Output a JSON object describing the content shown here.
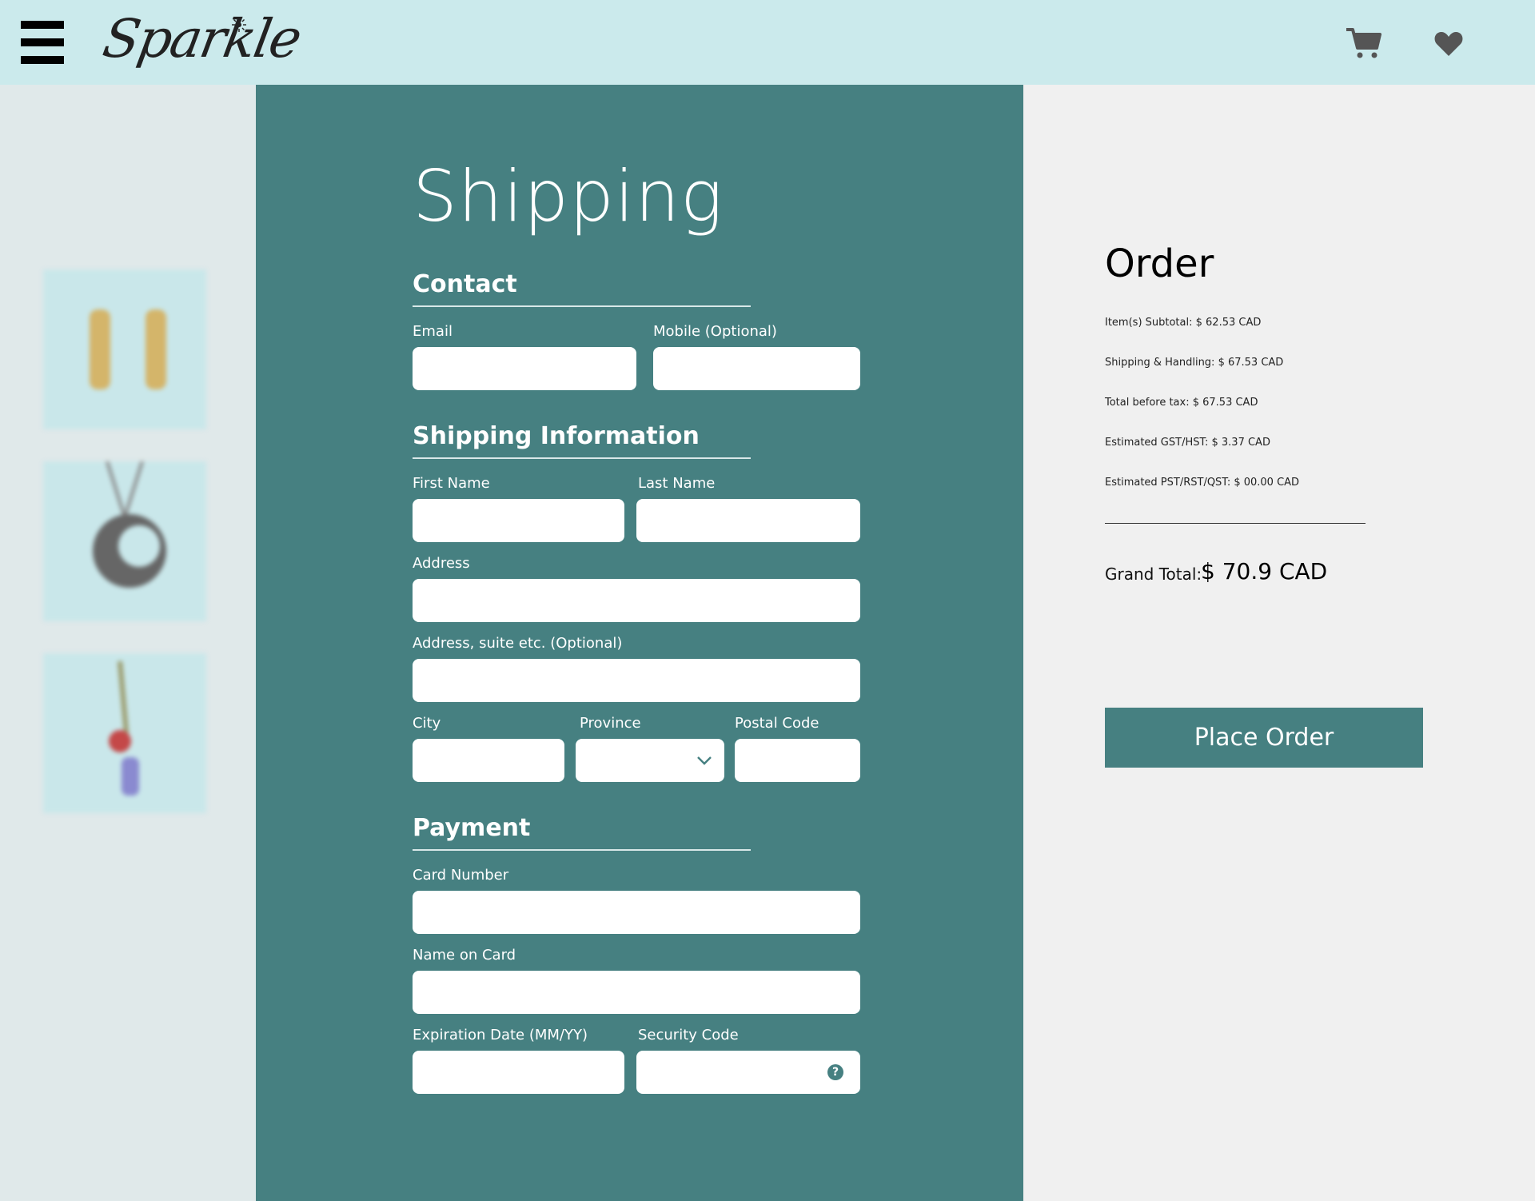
{
  "header": {
    "logo_text": "Sparkle",
    "menu_icon": "hamburger-icon",
    "cart_icon": "cart-icon",
    "wishlist_icon": "heart-icon",
    "background": "#cbeaec"
  },
  "form": {
    "title": "Shipping",
    "accent": "#468081",
    "contact": {
      "heading": "Contact",
      "email_label": "Email",
      "email_value": "",
      "mobile_label": "Mobile (Optional)",
      "mobile_value": ""
    },
    "shipping_info": {
      "heading": "Shipping Information",
      "first_name_label": "First Name",
      "last_name_label": "Last Name",
      "address_label": "Address",
      "address2_label": "Address, suite etc. (Optional)",
      "city_label": "City",
      "province_label": "Province",
      "province_value": "",
      "postal_label": "Postal Code"
    },
    "payment": {
      "heading": "Payment",
      "card_number_label": "Card Number",
      "name_on_card_label": "Name on Card",
      "expiration_label": "Expiration Date (MM/YY)",
      "security_label": "Security Code",
      "help_icon": "question-circle-icon"
    }
  },
  "order": {
    "title": "Order",
    "lines": [
      "Item(s) Subtotal: $ 62.53 CAD",
      "Shipping & Handling: $ 67.53 CAD",
      "Total before tax: $ 67.53 CAD",
      "Estimated GST/HST: $ 3.37 CAD",
      "Estimated PST/RST/QST: $ 00.00 CAD"
    ],
    "grand_total_label": "Grand Total:",
    "grand_total_value": "$ 70.9 CAD",
    "place_order_label": "Place Order"
  }
}
